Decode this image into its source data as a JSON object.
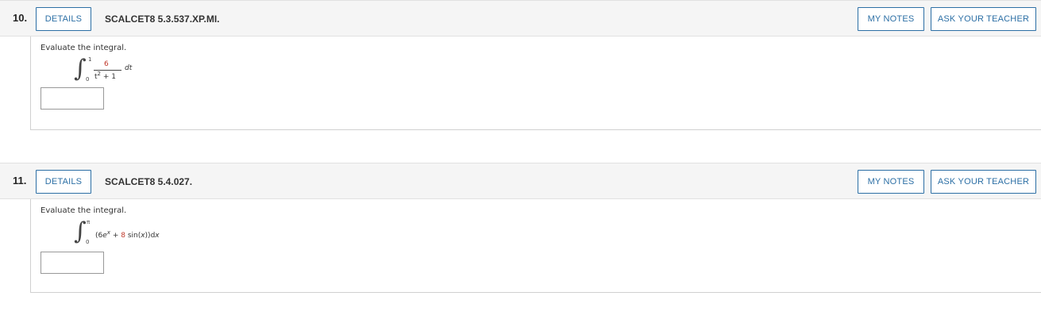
{
  "questions": [
    {
      "number": "10.",
      "details_label": "DETAILS",
      "code": "SCALCET8 5.3.537.XP.MI.",
      "my_notes_label": "MY NOTES",
      "ask_teacher_label": "ASK YOUR TEACHER",
      "prompt": "Evaluate the integral.",
      "integral": {
        "upper": "1",
        "lower": "0",
        "numerator": "6",
        "denominator_base": "t",
        "denominator_exp": "2",
        "denominator_rest": "+ 1",
        "differential": "dt"
      },
      "answer_value": ""
    },
    {
      "number": "11.",
      "details_label": "DETAILS",
      "code": "SCALCET8 5.4.027.",
      "my_notes_label": "MY NOTES",
      "ask_teacher_label": "ASK YOUR TEACHER",
      "prompt": "Evaluate the integral.",
      "integral": {
        "upper": "π",
        "lower": "0",
        "open": "(",
        "coef1": "6",
        "base": "e",
        "exp": "x",
        "plus": " + ",
        "coef2": "8",
        "func": " sin(",
        "var": "x",
        "close": "))",
        "differential_d": "d",
        "differential_var": "x"
      },
      "answer_value": ""
    }
  ]
}
